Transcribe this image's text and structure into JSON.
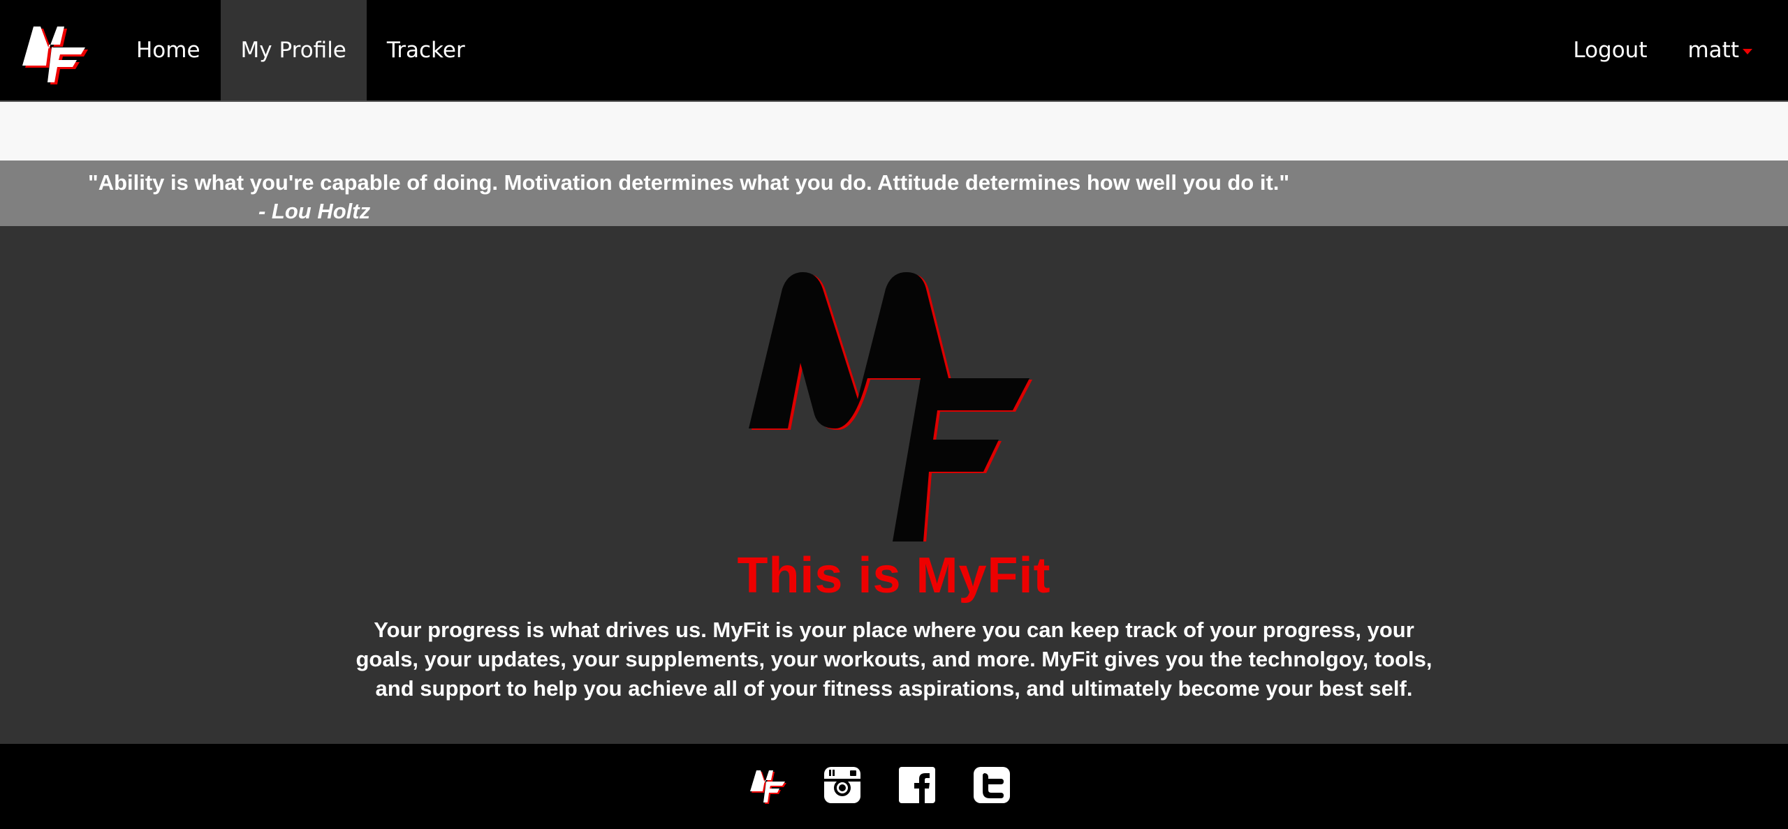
{
  "brand": {
    "logo_letters": "MF"
  },
  "nav": {
    "left": [
      {
        "label": "Home",
        "active": false
      },
      {
        "label": "My Profile",
        "active": true
      },
      {
        "label": "Tracker",
        "active": false
      }
    ],
    "logout_label": "Logout",
    "user_label": "matt"
  },
  "quote": {
    "text": "\"Ability is what you're capable of doing. Motivation determines what you do. Attitude determines how well you do it.\"",
    "author": "- Lou Holtz"
  },
  "hero": {
    "title": "This is MyFit",
    "description": "Your progress is what drives us. MyFit is your place where you can keep track of your progress, your goals, your updates, your supplements, your workouts, and more. MyFit gives you the technolgoy, tools, and support to help you achieve all of your fitness aspirations, and ultimately become your best self."
  },
  "footer": {
    "icons": [
      "myfit-logo-icon",
      "instagram-icon",
      "facebook-icon",
      "twitter-icon"
    ]
  },
  "colors": {
    "accent": "#ee0000",
    "navbar": "#000000",
    "hero_bg": "#333333",
    "quote_bg": "#808080"
  }
}
